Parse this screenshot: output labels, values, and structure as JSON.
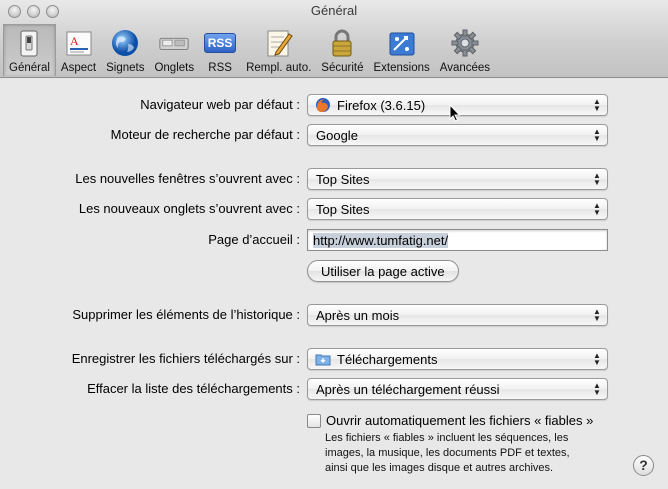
{
  "window": {
    "title": "Général"
  },
  "toolbar": {
    "items": [
      {
        "label": "Général",
        "icon": "switch-icon",
        "selected": true
      },
      {
        "label": "Aspect",
        "icon": "font-aspect-icon"
      },
      {
        "label": "Signets",
        "icon": "globe-icon"
      },
      {
        "label": "Onglets",
        "icon": "tabs-icon"
      },
      {
        "label": "RSS",
        "icon": "rss-icon"
      },
      {
        "label": "Rempl. auto.",
        "icon": "pencil-form-icon"
      },
      {
        "label": "Sécurité",
        "icon": "lock-icon"
      },
      {
        "label": "Extensions",
        "icon": "puzzle-icon"
      },
      {
        "label": "Avancées",
        "icon": "gear-icon"
      }
    ],
    "rss_text": "RSS"
  },
  "form": {
    "default_browser": {
      "label": "Navigateur web par défaut :",
      "value": "Firefox (3.6.15)",
      "icon": "firefox-icon"
    },
    "search_engine": {
      "label": "Moteur de recherche par défaut :",
      "value": "Google"
    },
    "new_windows": {
      "label": "Les nouvelles fenêtres s’ouvrent avec :",
      "value": "Top Sites"
    },
    "new_tabs": {
      "label": "Les nouveaux onglets s’ouvrent avec :",
      "value": "Top Sites"
    },
    "homepage": {
      "label": "Page d’accueil :",
      "value": "http://www.tumfatig.net/"
    },
    "use_current_page": "Utiliser la page active",
    "remove_history": {
      "label": "Supprimer les éléments de l’historique :",
      "value": "Après un mois"
    },
    "save_downloads": {
      "label": "Enregistrer les fichiers téléchargés sur :",
      "value": "Téléchargements",
      "icon": "folder-icon"
    },
    "clear_downloads": {
      "label": "Effacer la liste des téléchargements :",
      "value": "Après un téléchargement réussi"
    },
    "open_safe": {
      "label": "Ouvrir automatiquement les fichiers « fiables »",
      "checked": false,
      "description_lines": [
        "Les fichiers « fiables » incluent les séquences, les",
        "images, la musique, les documents PDF et textes,",
        "ainsi que les images disque et autres archives."
      ]
    }
  },
  "help": "?",
  "arrows": "▲▼"
}
